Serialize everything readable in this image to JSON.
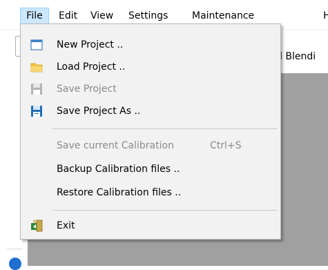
{
  "menubar": {
    "items": [
      "File",
      "Edit",
      "View",
      "Settings",
      "Maintenance",
      "H"
    ]
  },
  "background": {
    "partial_text": "d Blendi"
  },
  "file_menu": {
    "items": [
      {
        "label": "New Project ..",
        "icon": "window-icon",
        "enabled": true
      },
      {
        "label": "Load Project ..",
        "icon": "folder-icon",
        "enabled": true
      },
      {
        "label": "Save Project",
        "icon": "floppy-disk-icon",
        "enabled": false
      },
      {
        "label": "Save Project As ..",
        "icon": "floppy-disk-icon",
        "enabled": true
      },
      {
        "label": "Save current Calibration",
        "shortcut": "Ctrl+S",
        "enabled": false
      },
      {
        "label": "Backup Calibration files ..",
        "enabled": true
      },
      {
        "label": "Restore Calibration files ..",
        "enabled": true
      },
      {
        "label": "Exit",
        "icon": "exit-door-icon",
        "enabled": true
      }
    ]
  },
  "colors": {
    "menu_active_bg": "#cce8ff",
    "menu_bg": "#f2f2f2",
    "workspace_gray": "#a0a0a0",
    "disabled_text": "#8a8a8a"
  }
}
